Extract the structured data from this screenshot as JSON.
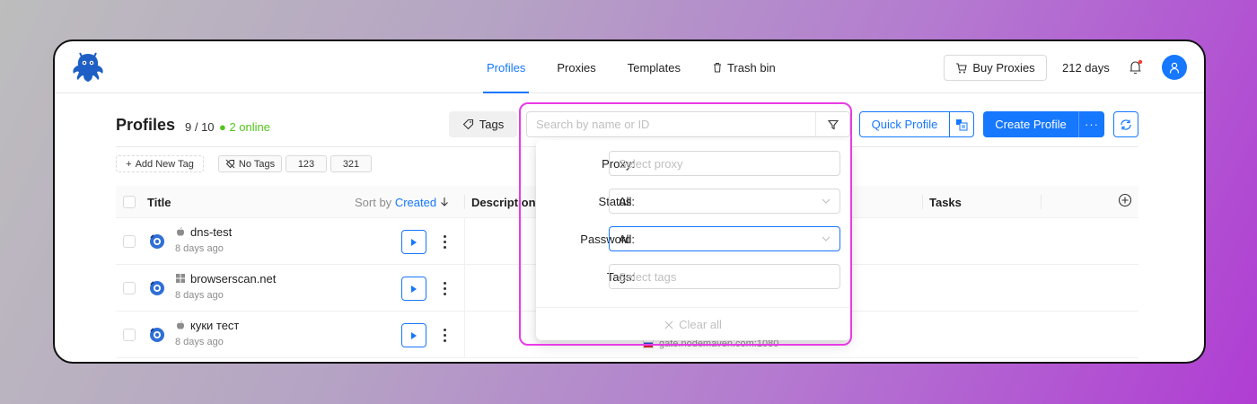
{
  "header": {
    "nav": [
      {
        "label": "Profiles",
        "active": true
      },
      {
        "label": "Proxies",
        "active": false
      },
      {
        "label": "Templates",
        "active": false
      },
      {
        "label": "Trash bin",
        "active": false
      }
    ],
    "buy_label": "Buy Proxies",
    "days_label": "212 days"
  },
  "toolbar": {
    "title": "Profiles",
    "count": "9 / 10",
    "online": "2 online",
    "tags_label": "Tags",
    "search_placeholder": "Search by name or ID",
    "quick_profile_label": "Quick Profile",
    "create_profile_label": "Create Profile",
    "more_label": "···"
  },
  "tag_chips": [
    {
      "label": "Add New Tag"
    },
    {
      "label": "No Tags"
    },
    {
      "label": "123"
    },
    {
      "label": "321"
    }
  ],
  "table": {
    "col_title": "Title",
    "sort_prefix": "Sort by",
    "sort_field": "Created",
    "col_description": "Description",
    "col_tasks": "Tasks",
    "rows": [
      {
        "name": "dns-test",
        "age": "8 days ago",
        "os": "mac"
      },
      {
        "name": "browserscan.net",
        "age": "8 days ago",
        "os": "windows"
      },
      {
        "name": "куки тест",
        "age": "8 days ago",
        "os": "mac"
      }
    ],
    "proxy_peek": "gate.nodemaven.com:1080"
  },
  "filter_panel": {
    "proxy": {
      "label": "Proxy:",
      "placeholder": "Select proxy"
    },
    "status": {
      "label": "Status:",
      "value": "All"
    },
    "password": {
      "label": "Password:",
      "value": "All"
    },
    "tags": {
      "label": "Tags:",
      "placeholder": "Select tags"
    },
    "clear_label": "Clear all"
  },
  "colors": {
    "accent": "#1677ff",
    "online": "#52c41a",
    "highlight": "#e93be6"
  }
}
